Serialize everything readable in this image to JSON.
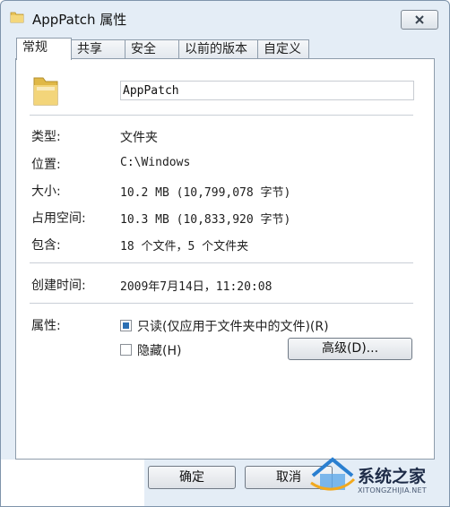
{
  "window": {
    "title": "AppPatch 属性",
    "close_icon": "close-icon"
  },
  "tabs": [
    {
      "label": "常规",
      "active": true
    },
    {
      "label": "共享",
      "active": false
    },
    {
      "label": "安全",
      "active": false
    },
    {
      "label": "以前的版本",
      "active": false
    },
    {
      "label": "自定义",
      "active": false
    }
  ],
  "general": {
    "folder_icon": "folder-icon",
    "name_value": "AppPatch",
    "rows": [
      {
        "label": "类型:",
        "value": "文件夹"
      },
      {
        "label": "位置:",
        "value": "C:\\Windows"
      },
      {
        "label": "大小:",
        "value": "10.2 MB (10,799,078 字节)"
      },
      {
        "label": "占用空间:",
        "value": "10.3 MB (10,833,920 字节)"
      },
      {
        "label": "包含:",
        "value": "18 个文件，5 个文件夹"
      }
    ],
    "created_label": "创建时间:",
    "created_value": "2009年7月14日，11:20:08",
    "attributes_label": "属性:",
    "readonly_label": "只读(仅应用于文件夹中的文件)(R)",
    "readonly_state": "indeterminate",
    "hidden_label": "隐藏(H)",
    "hidden_checked": false,
    "advanced_button": "高级(D)..."
  },
  "footer": {
    "ok_button": "确定",
    "cancel_button": "取消"
  },
  "watermark": {
    "text": "系统之家",
    "url": "XITONGZHIJIA.NET"
  }
}
